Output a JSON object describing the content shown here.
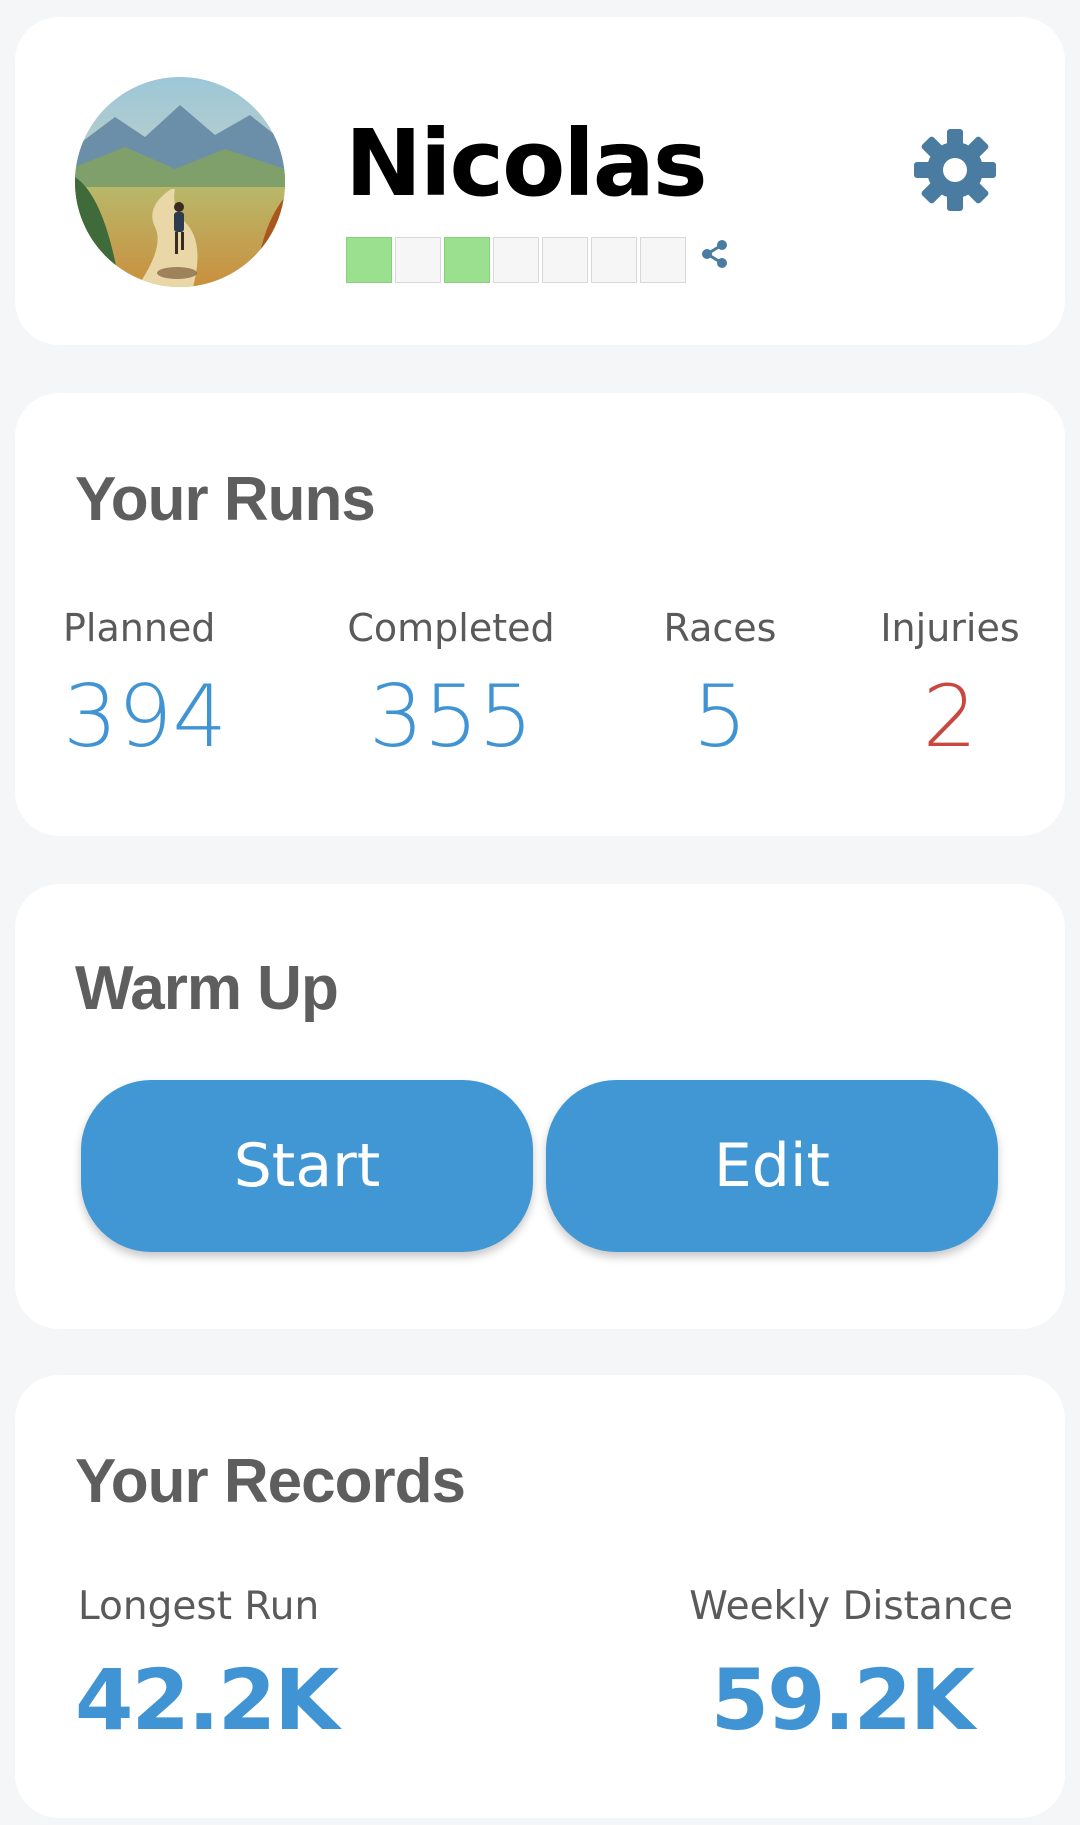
{
  "colors": {
    "background": "#f5f6f8",
    "card": "#ffffff",
    "accent": "#4196d4",
    "danger": "#c9473f",
    "streak_active": "#9ae08f",
    "settings_icon": "#4a7ba0",
    "title_text": "#5e5e5e"
  },
  "profile": {
    "name": "Nicolas",
    "avatar_icon": "runner-landscape-avatar",
    "streak": [
      true,
      false,
      true,
      false,
      false,
      false,
      false
    ],
    "share_icon": "share-icon",
    "settings_icon": "gear-icon"
  },
  "runs": {
    "title": "Your Runs",
    "stats": {
      "planned": {
        "label": "Planned",
        "value": "394"
      },
      "completed": {
        "label": "Completed",
        "value": "355"
      },
      "races": {
        "label": "Races",
        "value": "5"
      },
      "injuries": {
        "label": "Injuries",
        "value": "2"
      }
    }
  },
  "warmup": {
    "title": "Warm Up",
    "start_label": "Start",
    "edit_label": "Edit"
  },
  "records": {
    "title": "Your Records",
    "longest_run": {
      "label": "Longest Run",
      "value": "42.2K"
    },
    "weekly_distance": {
      "label": "Weekly Distance",
      "value": "59.2K"
    }
  }
}
